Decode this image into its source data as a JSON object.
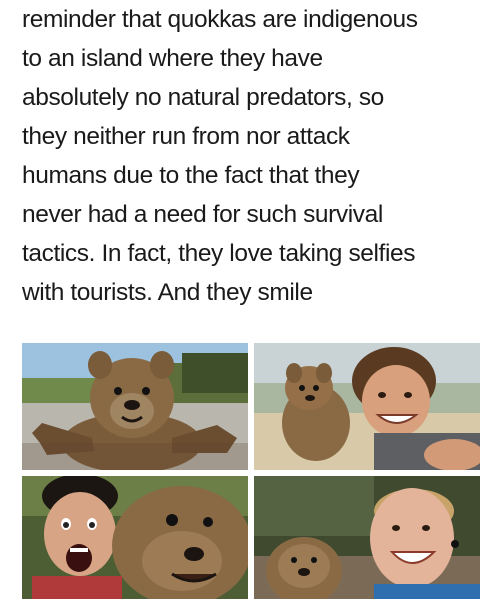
{
  "caption": {
    "lines": [
      "reminder that quokkas are indigenous",
      "to an island where they have",
      "absolutely no natural predators, so",
      "they neither run from nor attack",
      "humans due to the fact that they",
      "never had a need for such survival",
      "tactics. In fact, they love taking selfies",
      "with tourists. And they smile"
    ]
  },
  "photos": [
    {
      "subject": "quokka-arms-out-selfie"
    },
    {
      "subject": "man-with-quokka-selfie"
    },
    {
      "subject": "shouting-man-with-quokka-selfie"
    },
    {
      "subject": "smiling-man-with-quokka-selfie"
    }
  ],
  "colors": {
    "text": "#1a1a1a",
    "background": "#ffffff",
    "fur": "#8a6a45"
  }
}
